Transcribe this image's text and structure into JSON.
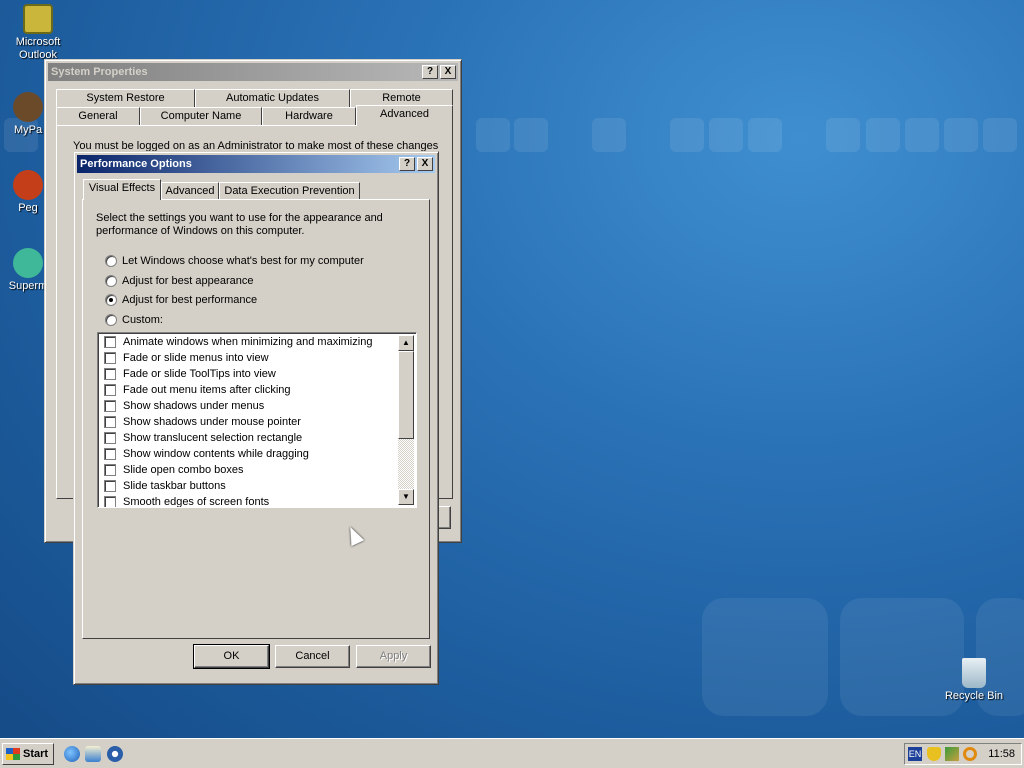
{
  "desktop": {
    "icons": [
      {
        "label": "Microsoft Outlook",
        "icon": "outlook-icon"
      },
      {
        "label": "MyPa",
        "icon": "my-documents-icon"
      },
      {
        "label": "Peg",
        "icon": "pegasus-icon"
      },
      {
        "label": "Superm",
        "icon": "superm-icon"
      },
      {
        "label": "Recycle Bin",
        "icon": "recycle-bin-icon"
      }
    ]
  },
  "system_properties": {
    "title": "System Properties",
    "help": "?",
    "close": "X",
    "tabs_row1": [
      "System Restore",
      "Automatic Updates",
      "Remote"
    ],
    "tabs_row2": [
      "General",
      "Computer Name",
      "Hardware",
      "Advanced"
    ],
    "notice": "You must be logged on as an Administrator to make most of these changes"
  },
  "performance_options": {
    "title": "Performance Options",
    "help": "?",
    "close": "X",
    "tabs": [
      "Visual Effects",
      "Advanced",
      "Data Execution Prevention"
    ],
    "description": "Select the settings you want to use for the appearance and performance of Windows on this computer.",
    "radios": [
      {
        "label": "Let Windows choose what's best for my computer",
        "selected": false
      },
      {
        "label": "Adjust for best appearance",
        "selected": false
      },
      {
        "label": "Adjust for best performance",
        "selected": true
      },
      {
        "label": "Custom:",
        "selected": false
      }
    ],
    "effects": [
      {
        "label": "Animate windows when minimizing and maximizing",
        "checked": false
      },
      {
        "label": "Fade or slide menus into view",
        "checked": false
      },
      {
        "label": "Fade or slide ToolTips into view",
        "checked": false
      },
      {
        "label": "Fade out menu items after clicking",
        "checked": false
      },
      {
        "label": "Show shadows under menus",
        "checked": false
      },
      {
        "label": "Show shadows under mouse pointer",
        "checked": false
      },
      {
        "label": "Show translucent selection rectangle",
        "checked": false
      },
      {
        "label": "Show window contents while dragging",
        "checked": false
      },
      {
        "label": "Slide open combo boxes",
        "checked": false
      },
      {
        "label": "Slide taskbar buttons",
        "checked": false
      },
      {
        "label": "Smooth edges of screen fonts",
        "checked": false
      }
    ],
    "buttons": {
      "ok": "OK",
      "cancel": "Cancel",
      "apply": "Apply"
    }
  },
  "taskbar": {
    "start_label": "Start",
    "quick_launch": [
      "internet-explorer-icon",
      "outlook-express-icon",
      "media-player-icon"
    ],
    "tray": {
      "language": "EN",
      "clock": "11:58"
    }
  },
  "colors": {
    "desktop": "#1c5b9c",
    "active_title": "#0a246a",
    "inactive_title": "#808080",
    "face": "#d4d0c8"
  }
}
